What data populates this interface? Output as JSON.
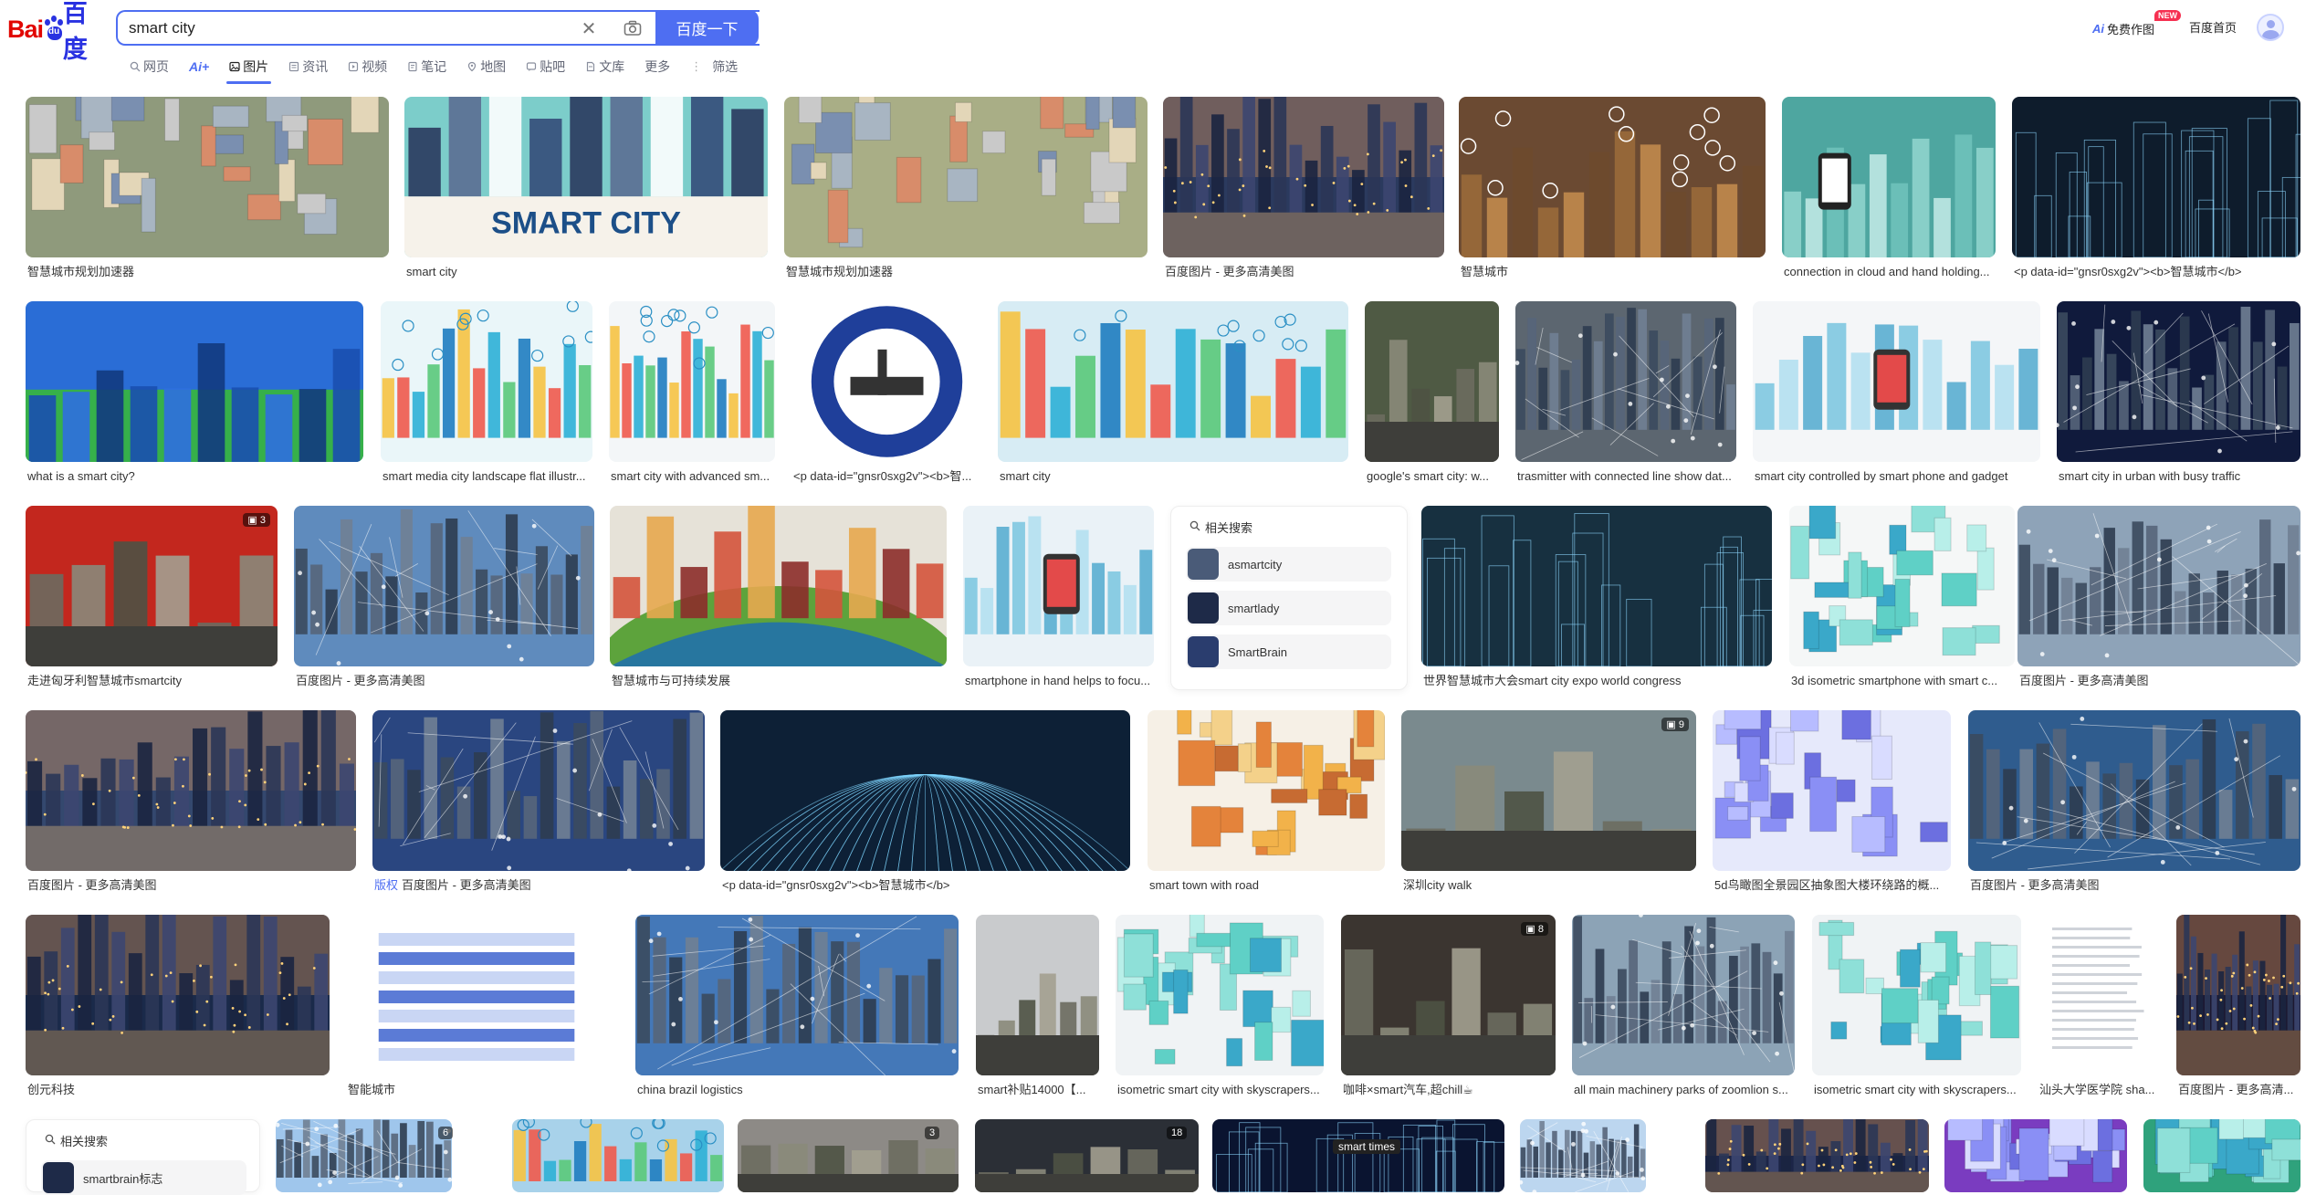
{
  "search": {
    "query": "smart city",
    "button": "百度一下"
  },
  "logo": {
    "text_pre": "Bai",
    "text_mid": "du",
    "text_cn": "百度"
  },
  "header": {
    "ai_image": "免费作图",
    "ai_badge_text": "Ai",
    "new_badge": "NEW",
    "home": "百度首页"
  },
  "tabs": [
    {
      "label": "网页",
      "icon": "search-icon"
    },
    {
      "label": "Ai+",
      "icon": "ai-icon"
    },
    {
      "label": "图片",
      "icon": "image-icon",
      "active": true
    },
    {
      "label": "资讯",
      "icon": "news-icon"
    },
    {
      "label": "视频",
      "icon": "video-icon"
    },
    {
      "label": "笔记",
      "icon": "note-icon"
    },
    {
      "label": "地图",
      "icon": "map-icon"
    },
    {
      "label": "贴吧",
      "icon": "forum-icon"
    },
    {
      "label": "文库",
      "icon": "doc-icon"
    },
    {
      "label": "更多",
      "icon": ""
    }
  ],
  "filter": "筛选",
  "related": {
    "title": "相关搜索",
    "items": [
      {
        "label": "asmartcity",
        "color": "#4a5b78"
      },
      {
        "label": "smartlady",
        "color": "#1e2a48"
      },
      {
        "label": "SmartBrain",
        "color": "#2a3d6e"
      }
    ],
    "title2": "相关搜索",
    "item2": "smartbrain标志"
  },
  "results": [
    {
      "caption": "智慧城市规划加速器",
      "bg": "#8f9a7c",
      "theme": "iso"
    },
    {
      "caption": "smart city",
      "bg": "#7ccdca",
      "theme": "logo",
      "text": "SMART CITY"
    },
    {
      "caption": "智慧城市规划加速器",
      "bg": "#a9ae86",
      "theme": "iso"
    },
    {
      "caption": "百度图片 - 更多高清美图",
      "bg": "#2b3a5e",
      "theme": "night"
    },
    {
      "caption": "智慧城市",
      "bg": "#6b4a32",
      "theme": "warm"
    },
    {
      "caption": "connection in cloud and hand holding...",
      "bg": "#4ea6a0",
      "theme": "teal"
    },
    {
      "caption": "<p data-id=\"gnsr0sxg2v\"><b>智慧城市</b>",
      "bg": "#0e1c2c",
      "theme": "dark"
    },
    {
      "caption": "what is a smart city?",
      "bg": "#2a6dd6",
      "theme": "blue"
    },
    {
      "caption": "smart media city landscape flat illustr...",
      "bg": "#eaf6f9",
      "theme": "flat"
    },
    {
      "caption": "smart city with advanced sm...",
      "bg": "#f3f6f8",
      "theme": "line"
    },
    {
      "caption": "<p data-id=\"gnsr0sxg2v\"><b>智...",
      "bg": "#ffffff",
      "theme": "badge"
    },
    {
      "caption": "smart city",
      "bg": "#d7ecf4",
      "theme": "flat2"
    },
    {
      "caption": "google's smart city: w...",
      "bg": "#4f5a44",
      "theme": "street"
    },
    {
      "caption": "trasmitter with connected line show dat...",
      "bg": "#5c6670",
      "theme": "gray"
    },
    {
      "caption": "smart city controlled by smart phone and gadget",
      "bg": "#f4f6f8",
      "theme": "phone"
    },
    {
      "caption": "smart city in urban with busy traffic",
      "bg": "#101a3c",
      "theme": "traffic"
    },
    {
      "caption": "走进匈牙利智慧城市smartcity",
      "bg": "#c3271e",
      "theme": "photo",
      "count": "3"
    },
    {
      "caption": "百度图片 - 更多高清美图",
      "bg": "#5f8bbd",
      "theme": "sky"
    },
    {
      "caption": "智慧城市与可持续发展",
      "bg": "#e6e2d8",
      "theme": "alive"
    },
    {
      "caption": "smartphone in hand helps to focu...",
      "bg": "#eaf2f7",
      "theme": "hand"
    },
    {
      "caption": "世界智慧城市大会smart city expo world congress",
      "bg": "#173040",
      "theme": "map3d"
    },
    {
      "caption": "3d isometric smartphone with smart c...",
      "bg": "#f5f7f7",
      "theme": "iso2"
    },
    {
      "caption": "百度图片 - 更多高清美图",
      "bg": "#8ea3b8",
      "theme": "mesh"
    },
    {
      "caption": "百度图片 - 更多高清美图",
      "bg": "#34486e",
      "theme": "dusk"
    },
    {
      "caption": "百度图片 - 更多高清美图",
      "bg": "#2a4680",
      "theme": "blue2",
      "tag": "版权"
    },
    {
      "caption": "<p data-id=\"gnsr0sxg2v\"><b>智慧城市</b>",
      "bg": "#0d2036",
      "theme": "arch"
    },
    {
      "caption": "smart town with road",
      "bg": "#f6f0e6",
      "theme": "town"
    },
    {
      "caption": "深圳city walk",
      "bg": "#7a8a8e",
      "theme": "walk",
      "count": "9"
    },
    {
      "caption": "5d鸟瞰图全景园区抽象图大楼环绕路的概...",
      "bg": "#e6e9fb",
      "theme": "purple"
    },
    {
      "caption": "百度图片 - 更多高清美图",
      "bg": "#2f5c8e",
      "theme": "aerial"
    },
    {
      "caption": "创元科技",
      "bg": "#1a2a4a",
      "theme": "night2"
    },
    {
      "caption": "智能城市",
      "bg": "#ffffff",
      "theme": "diagram"
    },
    {
      "caption": "china brazil logistics",
      "bg": "#4478b8",
      "theme": "bridge"
    },
    {
      "caption": "smart补贴14000【...",
      "bg": "#c9cbcd",
      "theme": "car"
    },
    {
      "caption": "isometric smart city with skyscrapers...",
      "bg": "#f0f3f5",
      "theme": "iso3"
    },
    {
      "caption": "咖啡×smart汽车,超chill☕",
      "bg": "#3b3530",
      "theme": "store",
      "count": "8"
    },
    {
      "caption": "all main machinery parks of zoomlion s...",
      "bg": "#8ca3b6",
      "theme": "factory"
    },
    {
      "caption": "isometric smart city with skyscrapers...",
      "bg": "#f0f3f5",
      "theme": "iso3"
    },
    {
      "caption": "汕头大学医学院 sha...",
      "bg": "#ffffff",
      "theme": "paper"
    },
    {
      "caption": "百度图片 - 更多高清...",
      "bg": "#1c1830",
      "theme": "tower"
    }
  ],
  "bottom_counts": [
    "6",
    "3",
    "18"
  ],
  "bottom_banner": "smart times"
}
